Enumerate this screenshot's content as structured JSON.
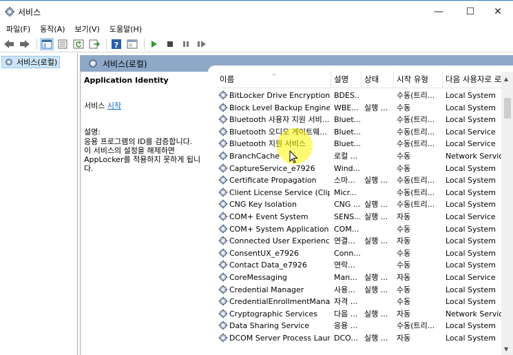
{
  "window": {
    "title": "서비스",
    "controls": {
      "minimize": "—",
      "maximize": "☐",
      "close": "✕"
    }
  },
  "menu": [
    "파일(F)",
    "동작(A)",
    "보기(V)",
    "도움말(H)"
  ],
  "toolbar": {
    "icons": [
      "back-icon",
      "forward-icon",
      "show-hide-tree-icon",
      "properties-icon",
      "refresh-icon",
      "export-icon",
      "help-icon",
      "toggle-pane-icon",
      "start-service-icon",
      "stop-service-icon",
      "pause-service-icon",
      "restart-service-icon"
    ]
  },
  "tree": {
    "item": "서비스(로컬)"
  },
  "pane": {
    "header": "서비스(로컬)",
    "details": {
      "title": "Application Identity",
      "action_prefix": "서비스",
      "action_link": "시작",
      "desc_label": "설명:",
      "desc_text": "응용 프로그램의 ID를 검증합니다.\n이 서비스의 설정을 해제하면\nAppLocker를 적용하지 못하게 됩니\n다."
    }
  },
  "table": {
    "columns": [
      "이름",
      "설명",
      "상태",
      "시작 유형",
      "다음 사용자로 로"
    ],
    "rows": [
      {
        "name": "BitLocker Drive Encryption ...",
        "desc": "BDES...",
        "state": "",
        "start": "수동(트리...",
        "logon": "Local System"
      },
      {
        "name": "Block Level Backup Engine ...",
        "desc": "WBE...",
        "state": "실행 ...",
        "start": "수동",
        "logon": "Local System"
      },
      {
        "name": "Bluetooth 사용자 지원 서비...",
        "desc": "Bluet...",
        "state": "",
        "start": "수동(트리...",
        "logon": "Local System"
      },
      {
        "name": "Bluetooth 오디오 게이트웨...",
        "desc": "Bluet...",
        "state": "",
        "start": "수동(트리...",
        "logon": "Local Service"
      },
      {
        "name": "Bluetooth 지원 서비스",
        "desc": "Bluet...",
        "state": "",
        "start": "수동(트리...",
        "logon": "Local Service"
      },
      {
        "name": "BranchCache",
        "desc": "로컬 ...",
        "state": "",
        "start": "수동",
        "logon": "Network Service"
      },
      {
        "name": "CaptureService_e7926",
        "desc": "Wind...",
        "state": "",
        "start": "수동",
        "logon": "Local System"
      },
      {
        "name": "Certificate Propagation",
        "desc": "스마...",
        "state": "실행 ...",
        "start": "수동(트리...",
        "logon": "Local System"
      },
      {
        "name": "Client License Service (ClipS...",
        "desc": "Micr...",
        "state": "",
        "start": "수동(트리...",
        "logon": "Local System"
      },
      {
        "name": "CNG Key Isolation",
        "desc": "CNG ...",
        "state": "실행 ...",
        "start": "수동(트리...",
        "logon": "Local System"
      },
      {
        "name": "COM+ Event System",
        "desc": "SENS...",
        "state": "실행 ...",
        "start": "자동",
        "logon": "Local Service"
      },
      {
        "name": "COM+ System Application",
        "desc": "COM...",
        "state": "",
        "start": "수동",
        "logon": "Local System"
      },
      {
        "name": "Connected User Experiences...",
        "desc": "연결...",
        "state": "실행 ...",
        "start": "자동",
        "logon": "Local System"
      },
      {
        "name": "ConsentUX_e7926",
        "desc": "Conn...",
        "state": "",
        "start": "수동",
        "logon": "Local System"
      },
      {
        "name": "Contact Data_e7926",
        "desc": "연락...",
        "state": "",
        "start": "수동",
        "logon": "Local System"
      },
      {
        "name": "CoreMessaging",
        "desc": "Man...",
        "state": "실행 ...",
        "start": "자동",
        "logon": "Local Service"
      },
      {
        "name": "Credential Manager",
        "desc": "사용...",
        "state": "실행 ...",
        "start": "수동",
        "logon": "Local System"
      },
      {
        "name": "CredentialEnrollmentManag...",
        "desc": "자격 ...",
        "state": "",
        "start": "수동",
        "logon": "Local System"
      },
      {
        "name": "Cryptographic Services",
        "desc": "다음 ...",
        "state": "실행 ...",
        "start": "자동",
        "logon": "Network Service"
      },
      {
        "name": "Data Sharing Service",
        "desc": "응용 ...",
        "state": "",
        "start": "수동(트리...",
        "logon": "Local System"
      },
      {
        "name": "DCOM Server Process Laun...",
        "desc": "DCO...",
        "state": "실행 ...",
        "start": "자동",
        "logon": "Local System"
      }
    ]
  }
}
